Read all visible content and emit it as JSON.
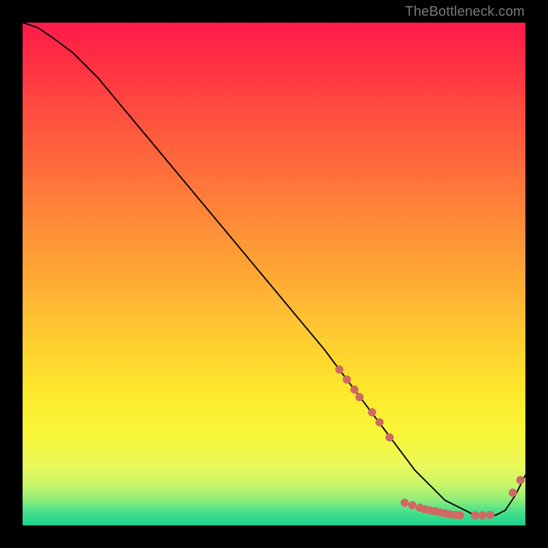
{
  "watermark": "TheBottleneck.com",
  "chart_data": {
    "type": "line",
    "title": "",
    "xlabel": "",
    "ylabel": "",
    "xlim": [
      0,
      100
    ],
    "ylim": [
      0,
      100
    ],
    "grid": false,
    "legend": false,
    "series": [
      {
        "name": "curve",
        "x": [
          0,
          3,
          6,
          10,
          15,
          20,
          25,
          30,
          35,
          40,
          45,
          50,
          55,
          60,
          63,
          66,
          69,
          72,
          75,
          78,
          80,
          82,
          84,
          86,
          88,
          90,
          92,
          94,
          96,
          98,
          100
        ],
        "y": [
          100,
          99,
          97,
          94,
          89,
          83,
          77,
          71,
          65,
          59,
          53,
          47,
          41,
          35,
          31,
          27,
          23,
          19,
          15,
          11,
          9,
          7,
          5,
          4,
          3,
          2,
          2,
          2,
          3,
          6,
          10
        ],
        "color": "#000000",
        "width": 2
      }
    ],
    "markers": [
      {
        "x": 63.0,
        "y": 31.0
      },
      {
        "x": 64.5,
        "y": 29.0
      },
      {
        "x": 66.0,
        "y": 27.0
      },
      {
        "x": 67.0,
        "y": 25.5
      },
      {
        "x": 69.5,
        "y": 22.5
      },
      {
        "x": 71.0,
        "y": 20.5
      },
      {
        "x": 73.0,
        "y": 17.5
      },
      {
        "x": 76.0,
        "y": 4.5
      },
      {
        "x": 77.5,
        "y": 4.0
      },
      {
        "x": 79.0,
        "y": 3.5
      },
      {
        "x": 80.0,
        "y": 3.2
      },
      {
        "x": 81.0,
        "y": 3.0
      },
      {
        "x": 82.0,
        "y": 2.8
      },
      {
        "x": 83.0,
        "y": 2.6
      },
      {
        "x": 84.0,
        "y": 2.4
      },
      {
        "x": 85.0,
        "y": 2.2
      },
      {
        "x": 86.0,
        "y": 2.1
      },
      {
        "x": 87.0,
        "y": 2.0
      },
      {
        "x": 90.0,
        "y": 2.0
      },
      {
        "x": 91.5,
        "y": 2.0
      },
      {
        "x": 93.0,
        "y": 2.1
      },
      {
        "x": 97.5,
        "y": 6.5
      },
      {
        "x": 99.0,
        "y": 9.0
      }
    ],
    "marker_style": {
      "color": "#cf6a63",
      "radius_px": 6
    }
  }
}
